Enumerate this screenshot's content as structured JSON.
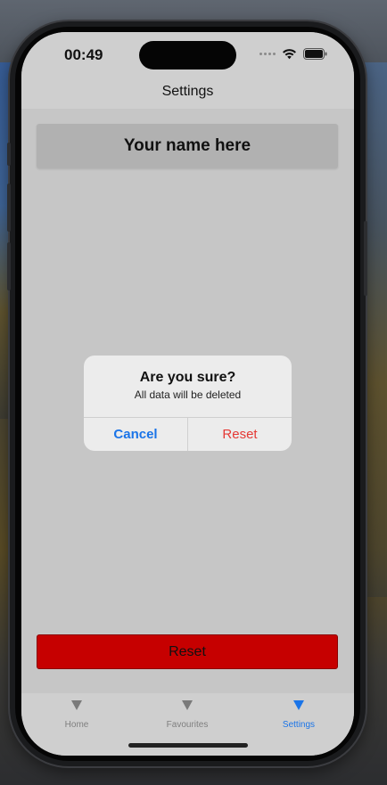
{
  "status_bar": {
    "time": "00:49",
    "icons": [
      "cellular-dots-icon",
      "wifi-icon",
      "battery-icon"
    ]
  },
  "nav": {
    "title": "Settings"
  },
  "content": {
    "name_field": "Your name here",
    "reset_button_label": "Reset"
  },
  "alert": {
    "title": "Are you sure?",
    "message": "All data will be deleted",
    "cancel_label": "Cancel",
    "confirm_label": "Reset"
  },
  "tab_bar": {
    "tabs": [
      {
        "label": "Home",
        "icon": "triangle-down-icon",
        "active": false
      },
      {
        "label": "Favourites",
        "icon": "triangle-down-icon",
        "active": false
      },
      {
        "label": "Settings",
        "icon": "triangle-down-icon",
        "active": true
      }
    ]
  },
  "colors": {
    "accent": "#1a74e8",
    "destructive": "#e53935",
    "reset_bar": "#c60000",
    "background": "#c6c6c6"
  }
}
